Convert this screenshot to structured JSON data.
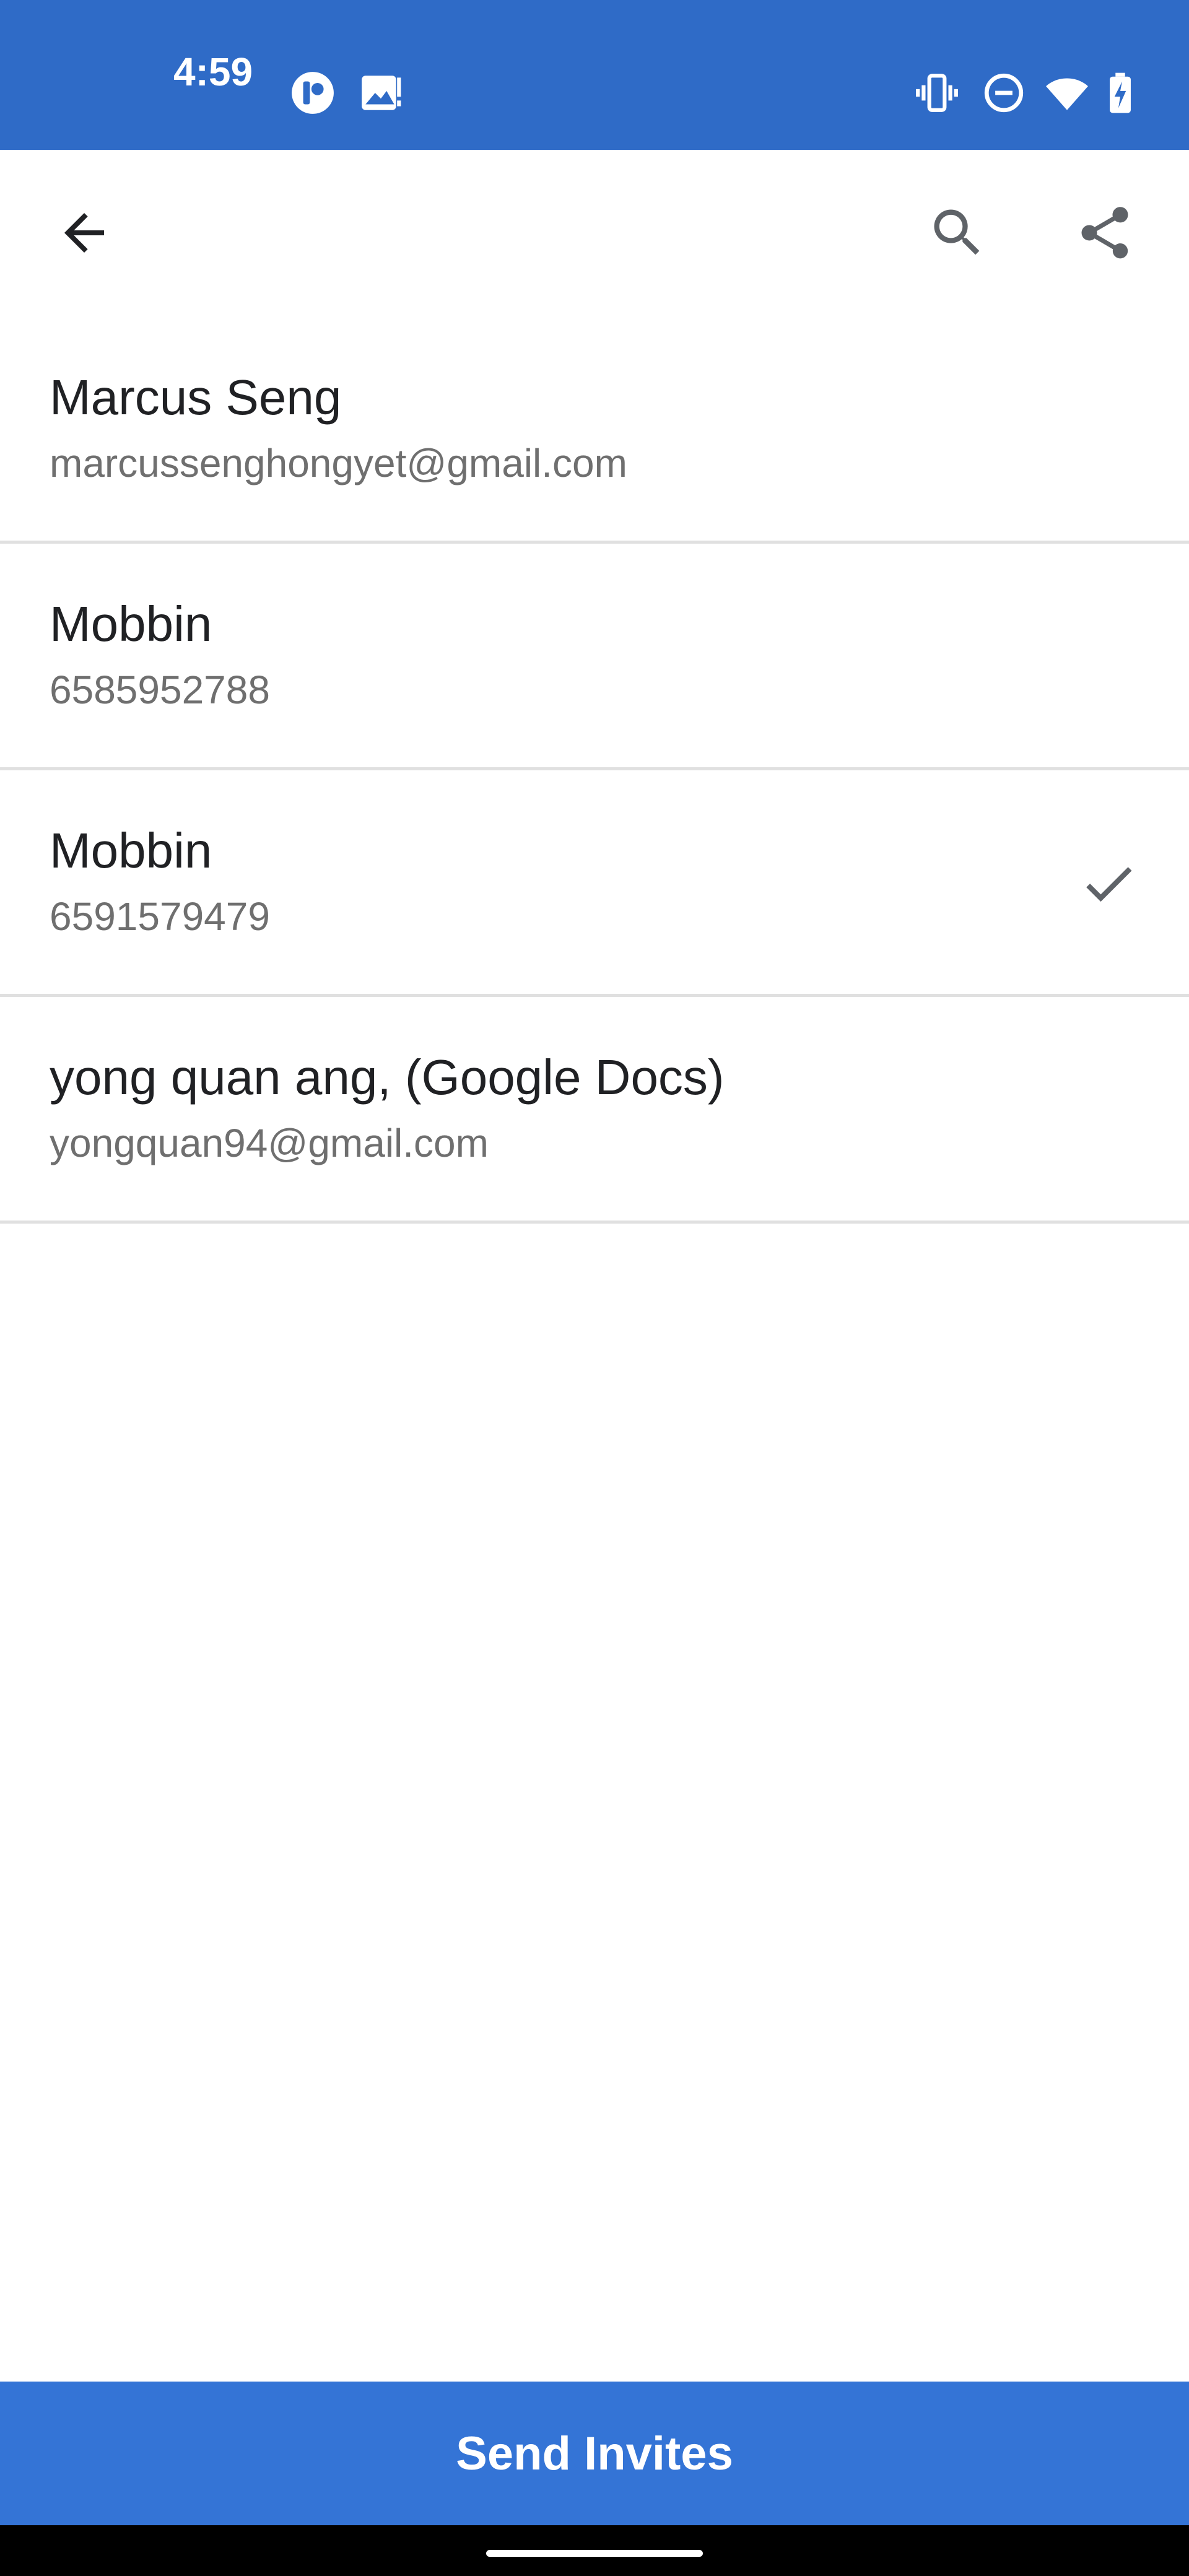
{
  "status_bar": {
    "time": "4:59",
    "icons": [
      "app-notification-icon",
      "image-notification-icon",
      "vibrate-icon",
      "do-not-disturb-icon",
      "wifi-icon",
      "battery-charging-icon"
    ]
  },
  "app_bar": {
    "back_icon": "arrow-left-icon",
    "search_icon": "search-icon",
    "share_icon": "share-icon"
  },
  "contacts": [
    {
      "name": "Marcus Seng",
      "detail": "marcussenghongyet@gmail.com",
      "selected": false
    },
    {
      "name": "Mobbin",
      "detail": "6585952788",
      "selected": false
    },
    {
      "name": "Mobbin",
      "detail": "6591579479",
      "selected": true
    },
    {
      "name": "yong quan ang, (Google Docs)",
      "detail": "yongquan94@gmail.com",
      "selected": false
    }
  ],
  "send_button": {
    "label": "Send Invites"
  },
  "colors": {
    "status_bar": "#2f6bc7",
    "primary_button": "#3474d6",
    "divider": "#e0e0e0",
    "text_primary": "#202124",
    "text_secondary": "#6f6f6f"
  }
}
